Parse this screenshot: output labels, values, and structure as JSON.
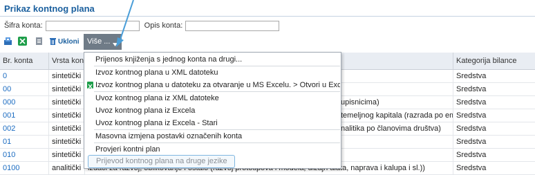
{
  "page_title": "Prikaz kontnog plana",
  "filters": {
    "sifra_label": "Šifra konta:",
    "sifra_value": "",
    "opis_label": "Opis konta:",
    "opis_value": ""
  },
  "toolbar": {
    "remove_label": "Ukloni",
    "more_label": "Više ..."
  },
  "grid": {
    "columns": [
      "Br. konta",
      "Vrsta kon",
      "Kategorija bilance"
    ],
    "rows": [
      {
        "konto": "0",
        "vrsta": "sintetički",
        "opis": "",
        "kategorija": "Sredstva"
      },
      {
        "konto": "00",
        "vrsta": "sintetički",
        "opis": "",
        "kategorija": "Sredstva"
      },
      {
        "konto": "000",
        "vrsta": "sintetički",
        "opis": "upisnicima)",
        "kategorija": "Sredstva"
      },
      {
        "konto": "001",
        "vrsta": "sintetički",
        "opis": "temeljnog kapitala (razrada po emi",
        "kategorija": "Sredstva"
      },
      {
        "konto": "002",
        "vrsta": "sintetički",
        "opis": "nalitika po članovima društva)",
        "kategorija": "Sredstva"
      },
      {
        "konto": "01",
        "vrsta": "sintetički",
        "opis": "",
        "kategorija": "Sredstva"
      },
      {
        "konto": "010",
        "vrsta": "sintetički",
        "opis": "",
        "kategorija": "Sredstva"
      },
      {
        "konto": "0100",
        "vrsta": "analitički",
        "opis": "izdaci za razvoj, oblikovanje i ostalo (razvoj prototipova i modela, dizajn alata, naprava i kalupa i sl.))",
        "kategorija": "Sredstva"
      }
    ]
  },
  "menu": {
    "items": [
      "Prijenos knjiženja s jednog konta na drugi...",
      "Izvoz kontnog plana u XML datoteku",
      "Izvoz kontnog plana u datoteku za otvaranje u MS Excelu. > Otvori u Excelu",
      "Uvoz kontnog plana iz XML datoteke",
      "Uvoz kontnog plana iz Excela",
      "Uvoz kontnog plana iz Excela - Stari",
      "Masovna izmjena postavki označenih konta",
      "Provjeri kontni plan",
      "Prijevod kontnog plana na druge jezike"
    ]
  },
  "colors": {
    "accent": "#1a5f9e",
    "link": "#1a6bc1",
    "callout": "#4a9ed8",
    "excel": "#1e9e4a"
  }
}
